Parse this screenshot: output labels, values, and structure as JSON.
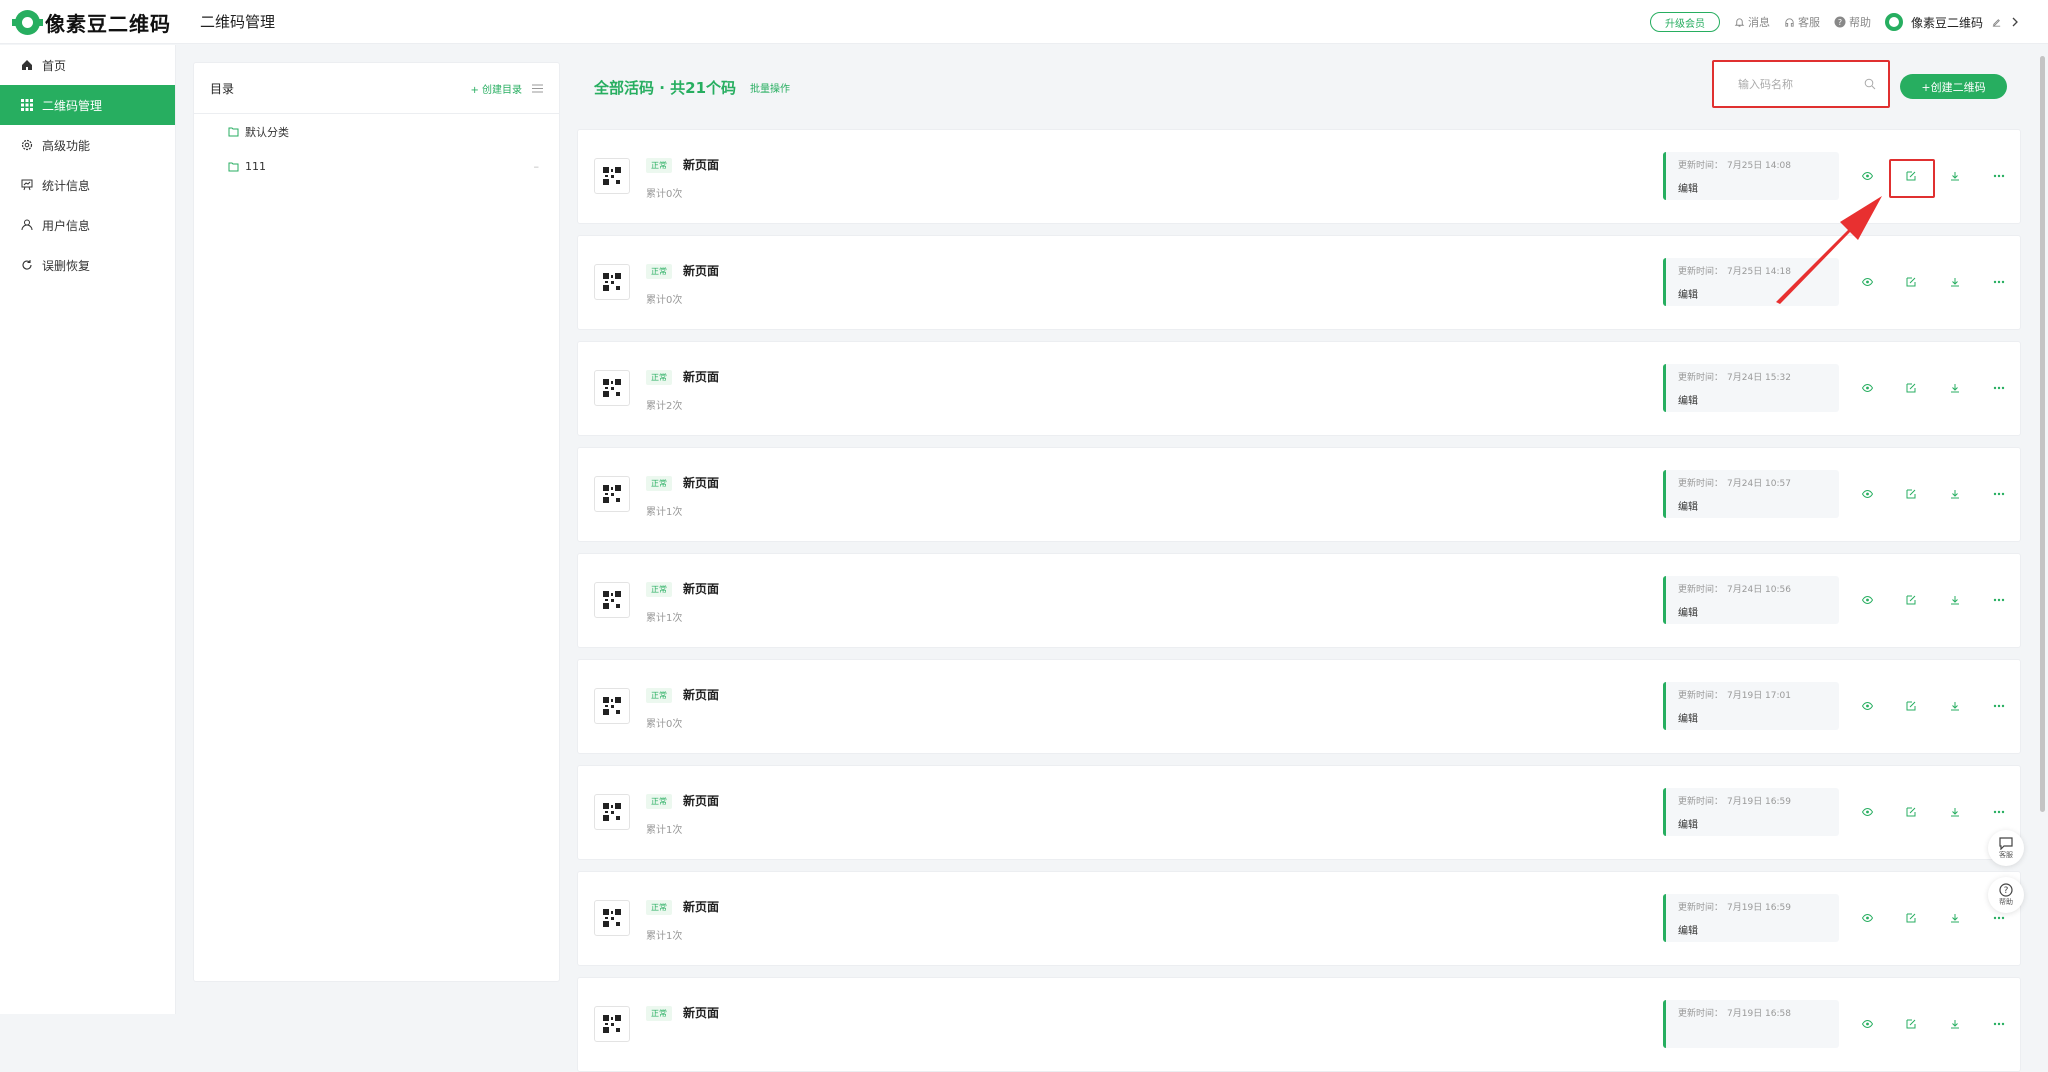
{
  "app": {
    "logo_text": "像素豆二维码",
    "page_title": "二维码管理"
  },
  "topbar": {
    "upgrade_label": "升级会员",
    "message_label": "消息",
    "service_label": "客服",
    "help_label": "帮助",
    "user_name": "像素豆二维码"
  },
  "sidebar": {
    "items": [
      {
        "label": "首页",
        "icon": "home-icon",
        "active": false
      },
      {
        "label": "二维码管理",
        "icon": "grid-icon",
        "active": true
      },
      {
        "label": "高级功能",
        "icon": "gear-icon",
        "active": false
      },
      {
        "label": "统计信息",
        "icon": "chart-board-icon",
        "active": false
      },
      {
        "label": "用户信息",
        "icon": "user-icon",
        "active": false
      },
      {
        "label": "误删恢复",
        "icon": "restore-icon",
        "active": false
      }
    ]
  },
  "catalog": {
    "title": "目录",
    "create_label": "+ 创建目录",
    "items": [
      {
        "label": "默认分类"
      },
      {
        "label": "111"
      }
    ]
  },
  "main": {
    "title": "全部活码 · 共21个码",
    "batch_label": "批量操作",
    "search_placeholder": "输入码名称",
    "create_button": "+创建二维码"
  },
  "codes": [
    {
      "status": "正常",
      "name": "新页面",
      "count": "累计0次",
      "update_label": "更新时间：",
      "update_time": "7月25日 14:08",
      "edit_label": "编辑"
    },
    {
      "status": "正常",
      "name": "新页面",
      "count": "累计0次",
      "update_label": "更新时间：",
      "update_time": "7月25日 14:18",
      "edit_label": "编辑"
    },
    {
      "status": "正常",
      "name": "新页面",
      "count": "累计2次",
      "update_label": "更新时间：",
      "update_time": "7月24日 15:32",
      "edit_label": "编辑"
    },
    {
      "status": "正常",
      "name": "新页面",
      "count": "累计1次",
      "update_label": "更新时间：",
      "update_time": "7月24日 10:57",
      "edit_label": "编辑"
    },
    {
      "status": "正常",
      "name": "新页面",
      "count": "累计1次",
      "update_label": "更新时间：",
      "update_time": "7月24日 10:56",
      "edit_label": "编辑"
    },
    {
      "status": "正常",
      "name": "新页面",
      "count": "累计0次",
      "update_label": "更新时间：",
      "update_time": "7月19日 17:01",
      "edit_label": "编辑"
    },
    {
      "status": "正常",
      "name": "新页面",
      "count": "累计1次",
      "update_label": "更新时间：",
      "update_time": "7月19日 16:59",
      "edit_label": "编辑"
    },
    {
      "status": "正常",
      "name": "新页面",
      "count": "累计1次",
      "update_label": "更新时间：",
      "update_time": "7月19日 16:59",
      "edit_label": "编辑"
    },
    {
      "status": "正常",
      "name": "新页面",
      "count": "",
      "update_label": "更新时间：",
      "update_time": "7月19日 16:58",
      "edit_label": ""
    }
  ],
  "floating": {
    "service_label": "客服",
    "help_label": "帮助"
  },
  "colors": {
    "accent": "#27ae60",
    "highlight": "#e03030"
  }
}
